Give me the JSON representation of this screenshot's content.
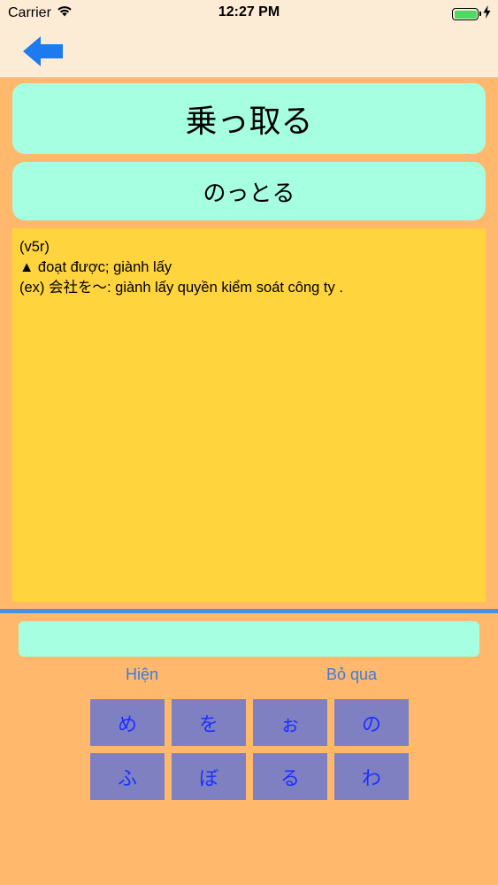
{
  "status_bar": {
    "carrier": "Carrier",
    "time": "12:27 PM",
    "battery_color": "#4cd964"
  },
  "nav": {
    "back_icon": "back-arrow-icon",
    "accent_color": "#1e7bef"
  },
  "word": {
    "kanji": "乗っ取る",
    "kana": "のっとる"
  },
  "meaning": {
    "lines": [
      "(v5r)",
      "▲ đoạt được; giành lấy",
      "(ex) 会社を〜: giành lấy quyền kiểm soát công ty ."
    ]
  },
  "answer": {
    "value": "",
    "placeholder": ""
  },
  "actions": {
    "show_label": "Hiện",
    "skip_label": "Bỏ qua"
  },
  "keys": [
    "め",
    "を",
    "ぉ",
    "の",
    "ふ",
    "ぼ",
    "る",
    "わ"
  ]
}
